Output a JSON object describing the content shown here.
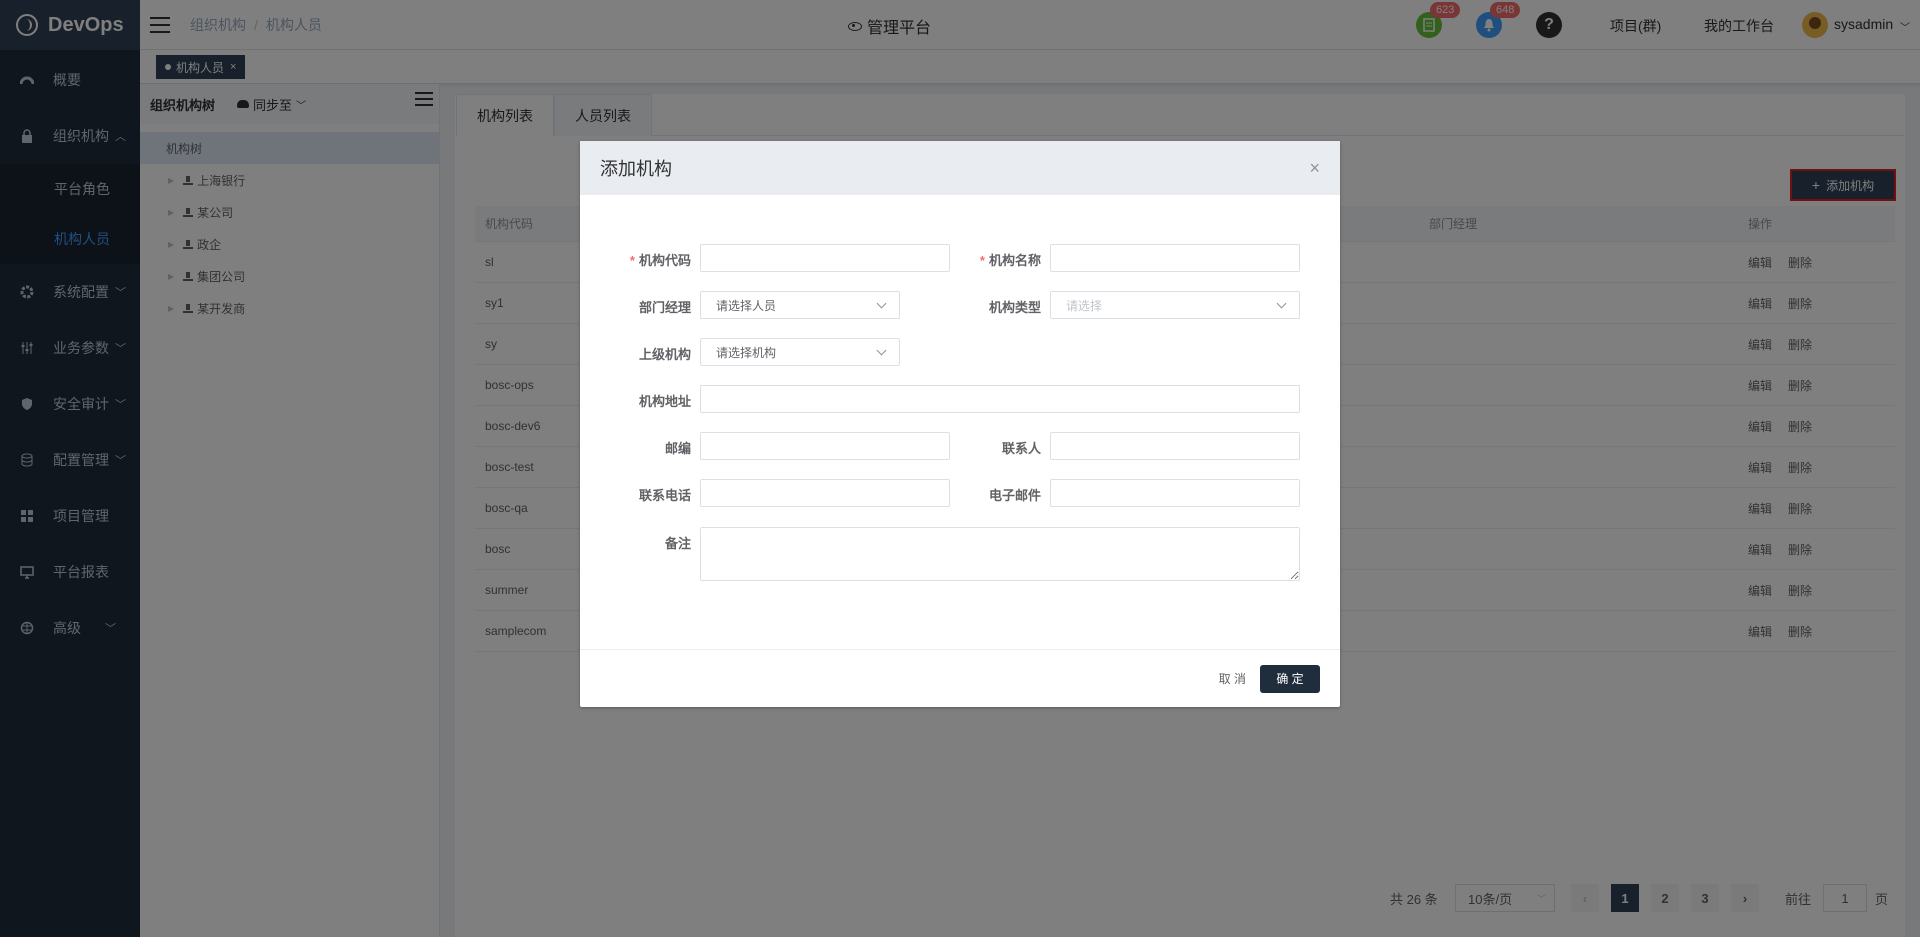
{
  "app": {
    "title": "DevOps"
  },
  "sidebar": {
    "items": [
      {
        "label": "概要",
        "icon": "dashboard-icon"
      },
      {
        "label": "组织机构",
        "icon": "lock-icon"
      },
      {
        "label": "平台角色"
      },
      {
        "label": "机构人员"
      },
      {
        "label": "系统配置",
        "icon": "gear-icon"
      },
      {
        "label": "业务参数",
        "icon": "sliders-icon"
      },
      {
        "label": "安全审计",
        "icon": "shield-icon"
      },
      {
        "label": "配置管理",
        "icon": "database-icon"
      },
      {
        "label": "项目管理",
        "icon": "grid-icon"
      },
      {
        "label": "平台报表",
        "icon": "monitor-icon"
      },
      {
        "label": "高级",
        "icon": "brain-icon"
      }
    ],
    "active_color": "#409eff"
  },
  "header": {
    "breadcrumb": [
      "组织机构",
      "机构人员"
    ],
    "center_title": "管理平台",
    "doc_badge": "623",
    "bell_badge": "648",
    "project_link": "项目(群)",
    "workbench_link": "我的工作台",
    "user": "sysadmin"
  },
  "tagsview": {
    "tag": "机构人员"
  },
  "tree": {
    "title": "组织机构树",
    "sync": "同步至",
    "root": "机构树",
    "children": [
      "上海银行",
      "某公司",
      "政企",
      "集团公司",
      "某开发商"
    ]
  },
  "main": {
    "tabs": [
      "机构列表",
      "人员列表"
    ],
    "add_button": "添加机构",
    "columns": [
      "机构代码",
      "部门经理",
      "操作"
    ],
    "rows": [
      "sl",
      "sy1",
      "sy",
      "bosc-ops",
      "bosc-dev6",
      "bosc-test",
      "bosc-qa",
      "bosc",
      "summer",
      "samplecom"
    ],
    "edit": "编辑",
    "delete": "删除"
  },
  "pager": {
    "total": "共 26 条",
    "page_size": "10条/页",
    "pages": [
      "1",
      "2",
      "3"
    ],
    "goto_label": "前往",
    "goto_value": "1",
    "page_suffix": "页"
  },
  "modal": {
    "title": "添加机构",
    "fields": {
      "code": "机构代码",
      "name": "机构名称",
      "manager": "部门经理",
      "manager_ph": "请选择人员",
      "type": "机构类型",
      "type_ph": "请选择",
      "parent": "上级机构",
      "parent_ph": "请选择机构",
      "address": "机构地址",
      "zip": "邮编",
      "contact": "联系人",
      "phone": "联系电话",
      "email": "电子邮件",
      "remark": "备注"
    },
    "cancel": "取 消",
    "ok": "确 定"
  }
}
